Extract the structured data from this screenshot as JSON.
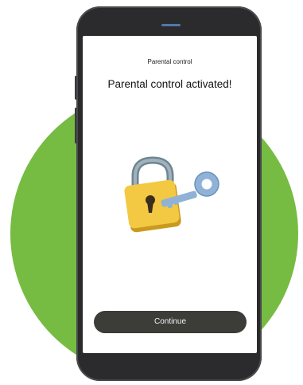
{
  "screen": {
    "header": "Parental control",
    "title": "Parental control activated!",
    "continue_label": "Continue"
  },
  "icons": {
    "illustration": "padlock-with-key-icon"
  },
  "colors": {
    "background_circle": "#76bc43",
    "phone_body": "#2b2b2d",
    "button": "#3c3c38",
    "lock_body": "#f3c842",
    "key": "#8fb2d6"
  }
}
